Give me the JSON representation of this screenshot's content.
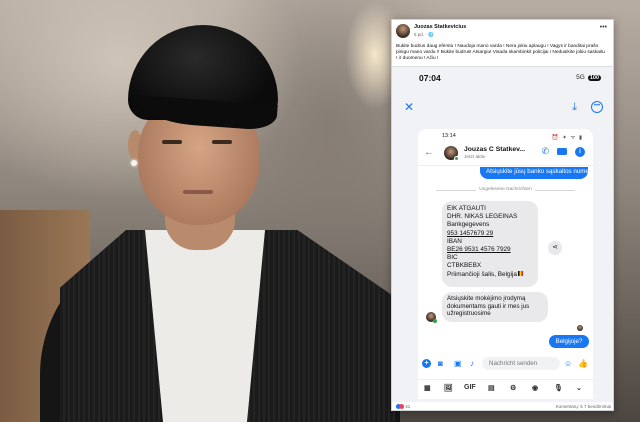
{
  "post": {
    "author": "Juozas Statkevicius",
    "meta": "5 pd. · 🌐",
    "text": "Bukite budrus daug efėrstu ! Naudoja mano varda ! Nera jokiu aplaugu ! Vagys ir banditai prašo pinigu mano vardu !! Bukite budrus! Atsargiu! Visada skambinkit policijai ! Nedusikite jokiu saskaitu ! ir duomenu ! Ačiu !",
    "menu": "•••",
    "reactions_count": "41",
    "comments": "Komentarų: 5",
    "shares": "7 bendrinimai"
  },
  "phone": {
    "time": "07:04",
    "status_right": "5G",
    "battery": "100",
    "close_icon": "✕",
    "download_icon": "⤓",
    "more_icon": "•••"
  },
  "chat": {
    "inner_time": "13:14",
    "inner_status_icons": "⏰ ✦ ᯤ ▮",
    "contact_name": "Jouzas C Statkev...",
    "contact_status": "Jetzt aktiv",
    "outgoing_1": "Atsiųskite jūsų banko sąskaitos numerį",
    "unread_divider": "Ungelesene Nachrichten",
    "incoming_1": {
      "l1": "EIK ATGAUTI",
      "l2": "DHR. NIKAS LEGEINAS",
      "l3": "Bankgegevens",
      "l4": "953 1457679 29",
      "l5": "IBAN",
      "l6": "BE26 9531 4576 7929",
      "l7": "BIC",
      "l8": "CTBKBEBX",
      "l9": "Priimančioji šalis, Belgija"
    },
    "incoming_2": {
      "l1": "Atsiųskite mokėjimo įrodymą",
      "l2": "dokumentams gauti ir mes jus",
      "l3": "užregistruosime"
    },
    "outgoing_2": "Belgijoje?",
    "composer_placeholder": "Nachricht senden",
    "nav": {
      "n1": "▦",
      "n2": "🖼",
      "n3": "GIF",
      "n4": "▤",
      "n5": "⚙",
      "n6": "◉",
      "n7": "🎙",
      "n8": "⌄"
    }
  }
}
